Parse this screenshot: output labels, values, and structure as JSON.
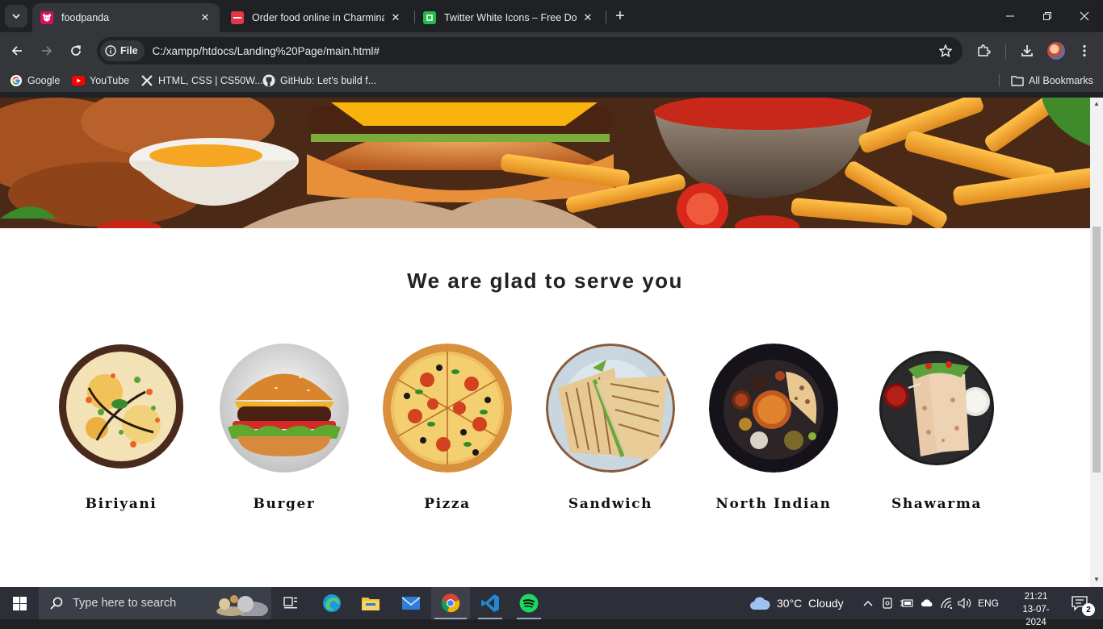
{
  "browser": {
    "tabs": [
      {
        "title": "foodpanda",
        "active": true,
        "favicon_color": "#d70f64"
      },
      {
        "title": "Order food online in Charminar",
        "active": false,
        "favicon_color": "#e23744"
      },
      {
        "title": "Twitter White Icons – Free Down",
        "active": false,
        "favicon_color": "#1fbc4c"
      }
    ],
    "address": {
      "security_chip": "File",
      "url": "C:/xampp/htdocs/Landing%20Page/main.html#"
    },
    "bookmarks": [
      {
        "label": "Google",
        "icon": "google-icon"
      },
      {
        "label": "YouTube",
        "icon": "youtube-icon"
      },
      {
        "label": "HTML, CSS | CS50W...",
        "icon": "x-icon"
      },
      {
        "label": "GitHub: Let's build f...",
        "icon": "github-icon"
      }
    ],
    "all_bookmarks": "All Bookmarks"
  },
  "page": {
    "heading": "We are glad to serve you",
    "items": [
      {
        "label": "Biriyani",
        "icon": "biriyani-image"
      },
      {
        "label": "Burger",
        "icon": "burger-image"
      },
      {
        "label": "Pizza",
        "icon": "pizza-image"
      },
      {
        "label": "Sandwich",
        "icon": "sandwich-image"
      },
      {
        "label": "North Indian",
        "icon": "north-indian-image"
      },
      {
        "label": "Shawarma",
        "icon": "shawarma-image"
      }
    ]
  },
  "taskbar": {
    "search_placeholder": "Type here to search",
    "weather": "30°C  Cloudy",
    "language": "ENG",
    "time": "21:21",
    "date": "13-07-2024",
    "notifications": "2"
  },
  "colors": {
    "browser_dark": "#202124",
    "toolbar": "#35363a",
    "taskbar": "#2c2f38",
    "page_bg": "#ffffff"
  }
}
